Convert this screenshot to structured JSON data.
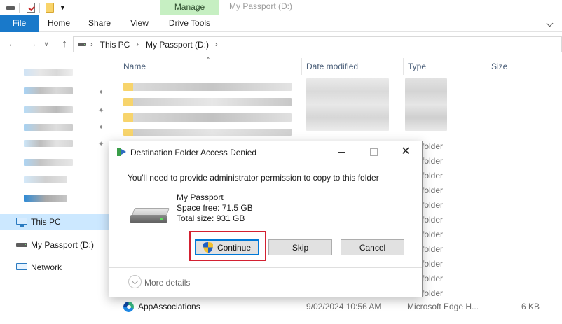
{
  "window": {
    "title": "My Passport (D:)"
  },
  "ribbon": {
    "context_group": "Manage",
    "tabs": [
      "File",
      "Home",
      "Share",
      "View",
      "Drive Tools"
    ]
  },
  "address_bar": {
    "crumbs": [
      "This PC",
      "My Passport (D:)"
    ]
  },
  "nav_pane": {
    "items": [
      {
        "label": "This PC",
        "icon": "pc-icon",
        "selected": true
      },
      {
        "label": "My Passport (D:)",
        "icon": "drive-icon",
        "selected": false
      },
      {
        "label": "Network",
        "icon": "network-icon",
        "selected": false
      }
    ]
  },
  "file_list": {
    "columns": [
      "Name",
      "Date modified",
      "Type",
      "Size"
    ],
    "folder_type_label": "folder",
    "visible_row": {
      "name": "AppAssociations",
      "date": "9/02/2024 10:56 AM",
      "type": "Microsoft Edge H...",
      "size": "6 KB"
    }
  },
  "dialog": {
    "title": "Destination Folder Access Denied",
    "message": "You'll need to provide administrator permission to copy to this folder",
    "drive_name": "My Passport",
    "space_free": "Space free: 71.5 GB",
    "total_size": "Total size: 931 GB",
    "buttons": {
      "continue": "Continue",
      "skip": "Skip",
      "cancel": "Cancel"
    },
    "more_details": "More details"
  },
  "colors": {
    "file_tab": "#1979ca",
    "manage_tab": "#c6efc2",
    "selected_nav": "#cce8ff",
    "highlight": "#d32030"
  }
}
